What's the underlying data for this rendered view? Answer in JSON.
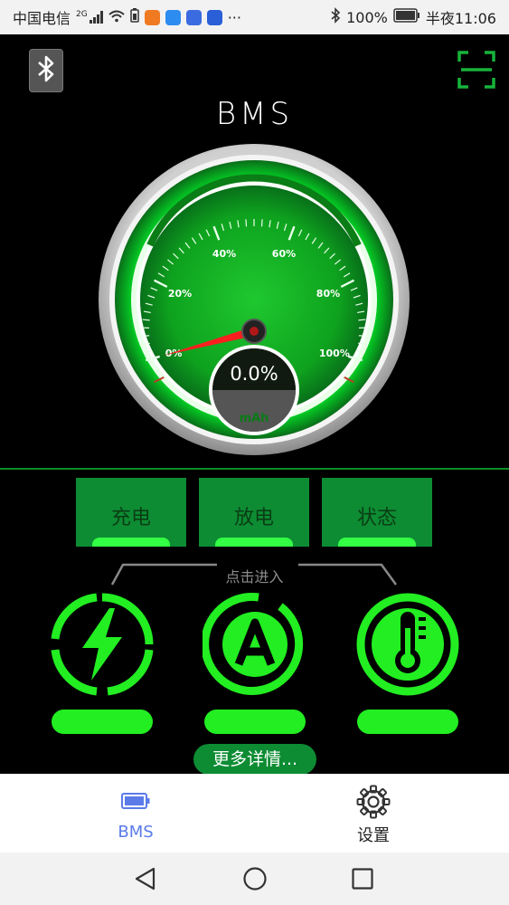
{
  "status_bar": {
    "carrier": "中国电信",
    "net_type": "2G",
    "more": "···",
    "battery_percent": "100%",
    "time": "半夜11:06"
  },
  "header": {
    "title": "BMS"
  },
  "gauge": {
    "value_text": "0.0%",
    "unit": "mAh",
    "ticks": [
      "0%",
      "20%",
      "40%",
      "60%",
      "80%",
      "100%"
    ],
    "needle_value_percent": 0
  },
  "tabs": [
    {
      "label": "充电"
    },
    {
      "label": "放电"
    },
    {
      "label": "状态"
    }
  ],
  "enter_label": "点击进入",
  "feature_icons": [
    {
      "icon": "lightning-icon"
    },
    {
      "icon": "ampere-icon"
    },
    {
      "icon": "thermometer-icon"
    }
  ],
  "more_button": "更多详情...",
  "bottom_nav": {
    "items": [
      {
        "label": "BMS",
        "icon": "battery-icon",
        "active": true
      },
      {
        "label": "设置",
        "icon": "gear-icon",
        "active": false
      }
    ]
  },
  "colors": {
    "accent_green": "#22ee22",
    "tab_green": "#0d8c33",
    "active_nav": "#5b7be8"
  }
}
